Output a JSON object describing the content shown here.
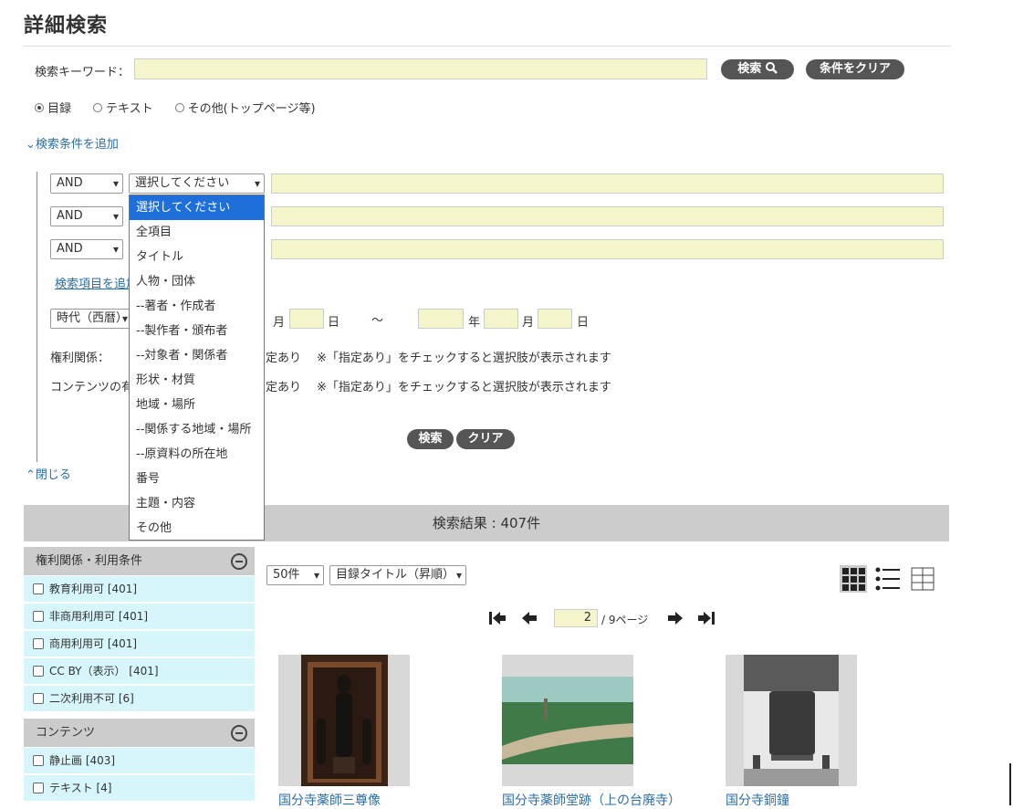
{
  "page_title": "詳細検索",
  "keyword": {
    "label": "検索キーワード：",
    "value": ""
  },
  "buttons": {
    "search": "検索",
    "clear_conditions": "条件をクリア",
    "search2": "検索",
    "clear2": "クリア"
  },
  "search_icon": "magnifier-icon",
  "radios": [
    {
      "label": "目録",
      "checked": true
    },
    {
      "label": "テキスト",
      "checked": false
    },
    {
      "label": "その他(トップページ等)",
      "checked": false
    }
  ],
  "add_condition": "検索条件を追加",
  "conditions": [
    {
      "op": "AND",
      "field": "選択してください"
    },
    {
      "op": "AND",
      "field": ""
    },
    {
      "op": "AND",
      "field": ""
    }
  ],
  "add_item_link": "検索項目を追加",
  "dropdown_options": [
    "選択してください",
    "全項目",
    "タイトル",
    "人物・団体",
    "--著者・作成者",
    "--製作者・頒布者",
    "--対象者・関係者",
    "形状・材質",
    "地域・場所",
    "--関係する地域・場所",
    "--原資料の所在地",
    "番号",
    "主題・内容",
    "その他"
  ],
  "era": {
    "select": "時代（西暦）",
    "month": "月",
    "day": "日",
    "tilde": "〜",
    "year": "年"
  },
  "rights": {
    "label": "権利関係：",
    "suffix": "定あり",
    "note": "※「指定あり」をチェックすると選択肢が表示されます"
  },
  "contents": {
    "label": "コンテンツの有",
    "suffix": "定あり",
    "note": "※「指定あり」をチェックすると選択肢が表示されます"
  },
  "close": "閉じる",
  "results": "検索結果 : 407件",
  "facets": [
    {
      "title": "権利関係・利用条件",
      "items": [
        "教育利用可  [401]",
        "非商用利用可  [401]",
        "商用利用可  [401]",
        "CC BY（表示）  [401]",
        "二次利用不可  [6]"
      ]
    },
    {
      "title": "コンテンツ",
      "items": [
        "静止画  [403]",
        "テキスト  [4]"
      ]
    }
  ],
  "per_page": "50件",
  "sort": "目録タイトル（昇順）",
  "page": {
    "current": "2",
    "suffix": "/ 9ページ"
  },
  "items": [
    {
      "title": "国分寺薬師三尊像"
    },
    {
      "title": "国分寺薬師堂跡（上の台廃寺）"
    },
    {
      "title": "国分寺銅鐘"
    }
  ]
}
